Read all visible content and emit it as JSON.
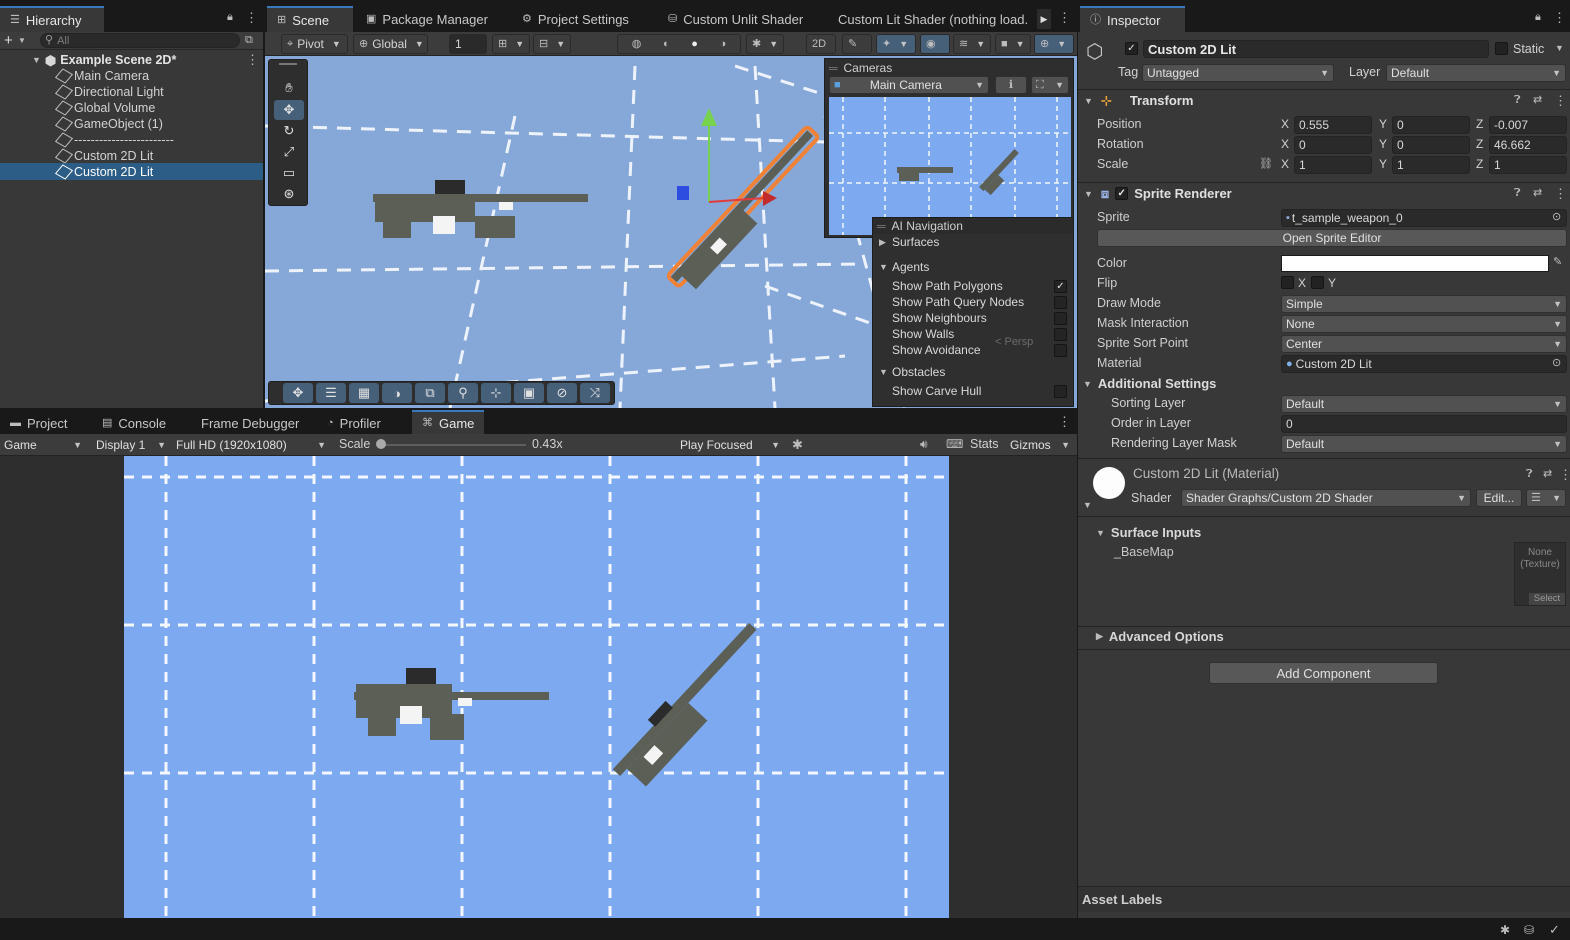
{
  "hierarchy": {
    "tab_label": "Hierarchy",
    "search_placeholder": "All",
    "scene_name": "Example Scene 2D*",
    "items": [
      "Main Camera",
      "Directional Light",
      "Global Volume",
      "GameObject (1)",
      "------------------------",
      "Custom 2D Lit",
      "Custom 2D Lit"
    ]
  },
  "scene_tabs": [
    "Scene",
    "Package Manager",
    "Project Settings",
    "Custom Unlit Shader",
    "Custom Lit Shader (nothing load."
  ],
  "scene_toolbar": {
    "pivot": "Pivot",
    "global": "Global",
    "grid_value": "1"
  },
  "cameras_overlay": {
    "title": "Cameras",
    "camera": "Main Camera"
  },
  "ai_navigation": {
    "title": "AI Navigation",
    "surfaces": "Surfaces",
    "agents": "Agents",
    "agent_items": [
      {
        "label": "Show Path Polygons",
        "checked": true
      },
      {
        "label": "Show Path Query Nodes",
        "checked": false
      },
      {
        "label": "Show Neighbours",
        "checked": false
      },
      {
        "label": "Show Walls",
        "checked": false
      },
      {
        "label": "Show Avoidance",
        "checked": false
      }
    ],
    "obstacles": "Obstacles",
    "obstacle_item": {
      "label": "Show Carve Hull",
      "checked": false
    },
    "persp": "< Persp"
  },
  "bottom_tabs": [
    "Project",
    "Console",
    "Frame Debugger",
    "Profiler",
    "Game"
  ],
  "game_toolbar": {
    "view": "Game",
    "display": "Display 1",
    "resolution": "Full HD (1920x1080)",
    "scale_label": "Scale",
    "scale_value": "0.43x",
    "play_mode": "Play Focused",
    "stats": "Stats",
    "gizmos": "Gizmos"
  },
  "inspector": {
    "tab_label": "Inspector",
    "object_name": "Custom 2D Lit",
    "static_label": "Static",
    "tag_label": "Tag",
    "tag_value": "Untagged",
    "layer_label": "Layer",
    "layer_value": "Default",
    "transform": {
      "title": "Transform",
      "position": {
        "label": "Position",
        "x": "0.555",
        "y": "0",
        "z": "-0.007"
      },
      "rotation": {
        "label": "Rotation",
        "x": "0",
        "y": "0",
        "z": "46.662"
      },
      "scale": {
        "label": "Scale",
        "x": "1",
        "y": "1",
        "z": "1"
      }
    },
    "sprite_renderer": {
      "title": "Sprite Renderer",
      "sprite_label": "Sprite",
      "sprite_value": "t_sample_weapon_0",
      "open_editor": "Open Sprite Editor",
      "color_label": "Color",
      "flip_label": "Flip",
      "flip_x": "X",
      "flip_y": "Y",
      "draw_mode_label": "Draw Mode",
      "draw_mode": "Simple",
      "mask_label": "Mask Interaction",
      "mask": "None",
      "sort_point_label": "Sprite Sort Point",
      "sort_point": "Center",
      "material_label": "Material",
      "material": "Custom 2D Lit",
      "additional": "Additional Settings",
      "sorting_layer_label": "Sorting Layer",
      "sorting_layer": "Default",
      "order_label": "Order in Layer",
      "order": "0",
      "render_mask_label": "Rendering Layer Mask",
      "render_mask": "Default"
    },
    "material": {
      "title": "Custom 2D Lit (Material)",
      "shader_label": "Shader",
      "shader": "Shader Graphs/Custom 2D Shader",
      "edit": "Edit...",
      "surface_inputs": "Surface Inputs",
      "base_map": "_BaseMap",
      "texture_none": "None",
      "texture_type": "(Texture)",
      "texture_select": "Select",
      "advanced": "Advanced Options"
    },
    "add_component": "Add Component",
    "asset_labels": "Asset Labels"
  },
  "colors": {
    "accent": "#3a79bb",
    "selection": "#2c5d87",
    "sky": "#7ca9f0",
    "scene_bg": "#86a8d8"
  }
}
